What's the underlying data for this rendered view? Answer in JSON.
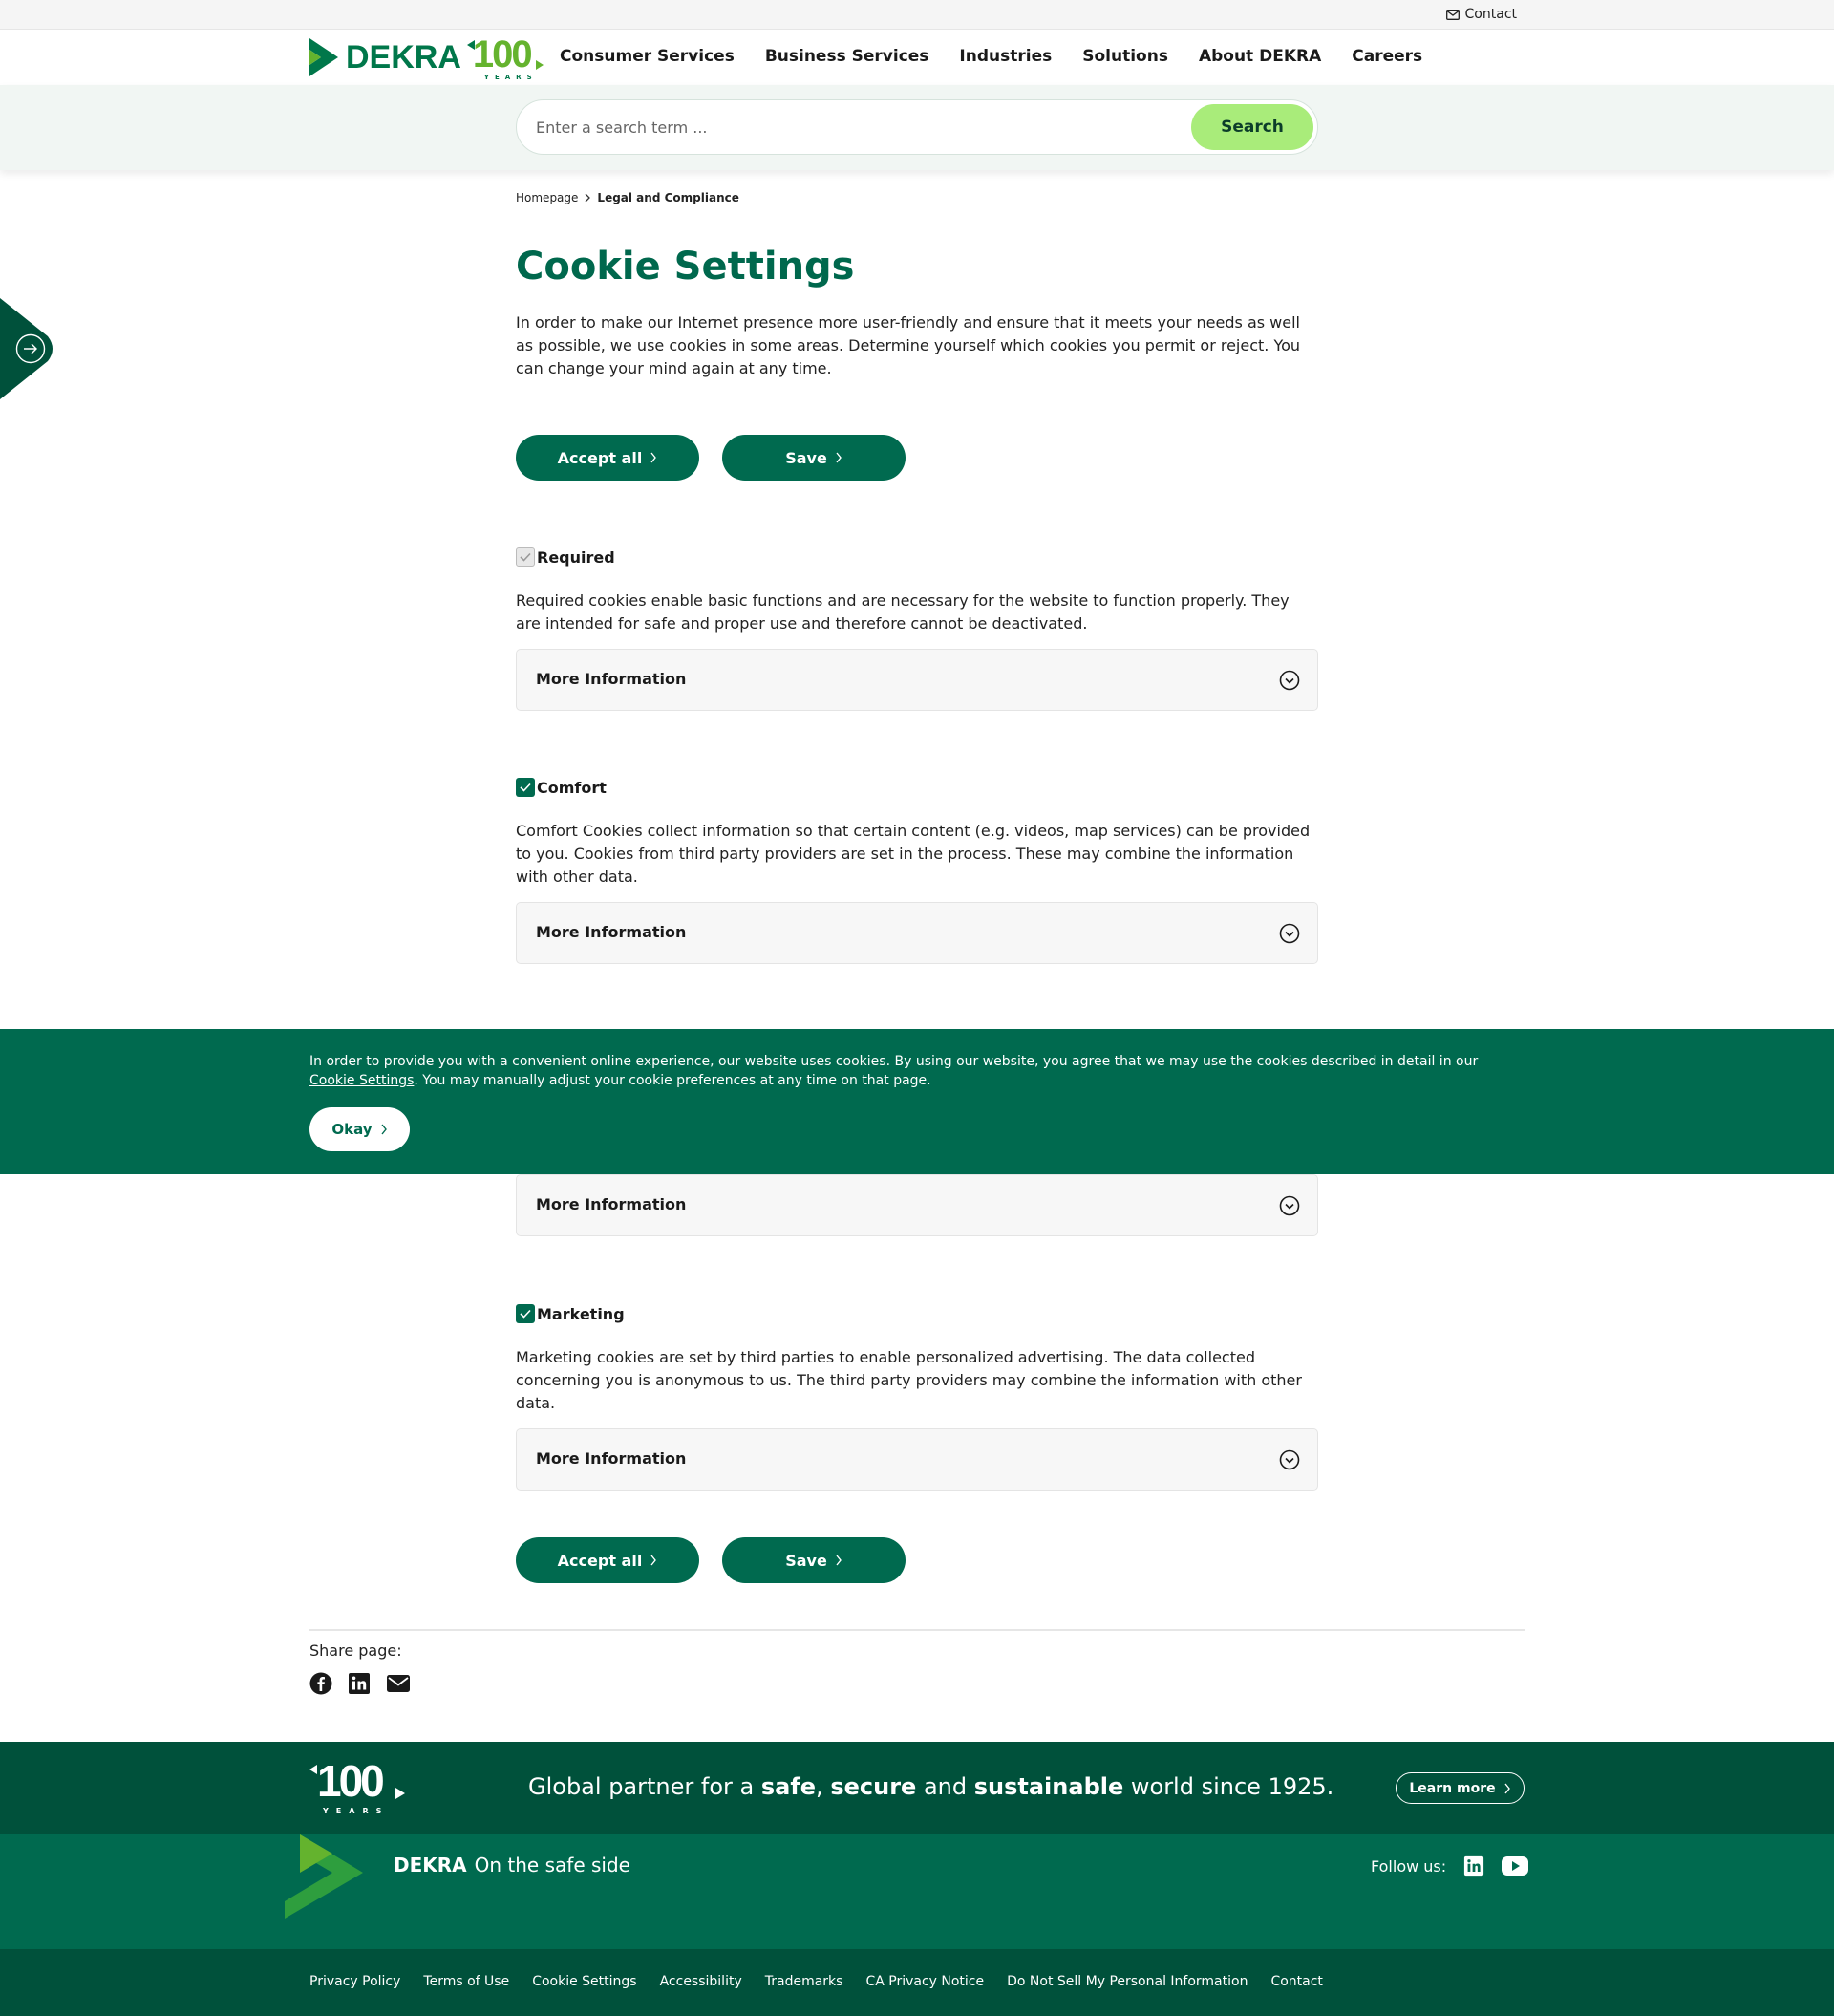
{
  "topbar": {
    "contact_label": "Contact"
  },
  "header": {
    "logo_word": "DEKRA",
    "logo_hundred": "100",
    "logo_years": "YEARS",
    "nav": [
      "Consumer Services",
      "Business Services",
      "Industries",
      "Solutions",
      "About DEKRA",
      "Careers"
    ]
  },
  "search": {
    "placeholder": "Enter a search term ...",
    "button_label": "Search"
  },
  "breadcrumb": {
    "home": "Homepage",
    "current": "Legal and Compliance"
  },
  "page": {
    "title": "Cookie Settings",
    "intro": "In order to make our Internet presence more user-friendly and ensure that it meets your needs as well as possible, we use cookies in some areas. Determine yourself which cookies you permit or reject. You can change your mind again at any time.",
    "accept_all_label": "Accept all",
    "save_label": "Save",
    "more_info_label": "More Information"
  },
  "sections": {
    "required": {
      "title": "Required",
      "checked": true,
      "disabled": true,
      "desc": "Required cookies enable basic functions and are necessary for the website to function properly. They are intended for safe and proper use and therefore cannot be deactivated."
    },
    "comfort": {
      "title": "Comfort",
      "checked": true,
      "desc": "Comfort Cookies collect information so that certain content (e.g. videos, map services) can be provided to you. Cookies from third party providers are set in the process. These may combine the information with other data."
    },
    "marketing": {
      "title": "Marketing",
      "checked": true,
      "desc": "Marketing cookies are set by third parties to enable personalized advertising. The data collected concerning you is anonymous to us. The third party providers may combine the information with other data."
    }
  },
  "cookie_banner": {
    "text_before": "In order to provide you with a convenient online experience, our website uses cookies. By using our website, you agree that we may use the cookies described in detail in our",
    "link_text": "Cookie Settings",
    "text_after": ". You may manually adjust your cookie preferences at any time on that page.",
    "okay_label": "Okay"
  },
  "share": {
    "label": "Share page:"
  },
  "footer": {
    "hundred": "100",
    "years": "YEARS",
    "tagline": {
      "part1": "Global partner for a ",
      "bold1": "safe",
      "sep1": ", ",
      "bold2": "secure",
      "sep2": " and ",
      "bold3": "sustainable",
      "part2": " world since 1925."
    },
    "learn_more_label": "Learn more",
    "brand_name": "DEKRA",
    "brand_slogan": "On the safe side",
    "follow_label": "Follow us:",
    "links": [
      "Privacy Policy",
      "Terms of Use",
      "Cookie Settings",
      "Accessibility",
      "Trademarks",
      "CA Privacy Notice",
      "Do Not Sell My Personal Information",
      "Contact"
    ]
  },
  "colors": {
    "brand_green": "#006a4f",
    "dark_green": "#00513b",
    "lime": "#a9ec7a",
    "logo_green": "#00774a"
  }
}
